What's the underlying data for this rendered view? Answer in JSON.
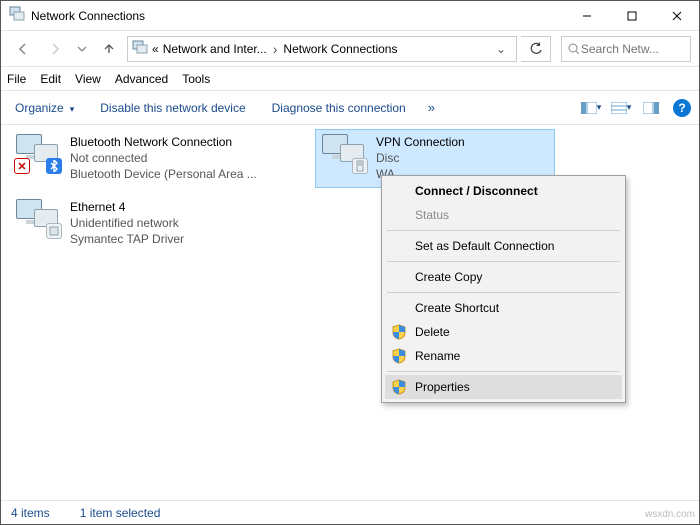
{
  "window": {
    "title": "Network Connections"
  },
  "nav": {
    "crumb1": "Network and Inter...",
    "crumb2": "Network Connections",
    "ellipsis": "«"
  },
  "search": {
    "placeholder": "Search Netw..."
  },
  "menu": {
    "file": "File",
    "edit": "Edit",
    "view": "View",
    "advanced": "Advanced",
    "tools": "Tools"
  },
  "cmd": {
    "organize": "Organize",
    "disable": "Disable this network device",
    "diagnose": "Diagnose this connection"
  },
  "connections": [
    {
      "name": "Bluetooth Network Connection",
      "status": "Not connected",
      "device": "Bluetooth Device (Personal Area ...",
      "icon": "bt",
      "selected": false
    },
    {
      "name": "Ethernet 4",
      "status": "Unidentified network",
      "device": "Symantec TAP Driver",
      "icon": "tap",
      "selected": false
    },
    {
      "name": "VPN Connection",
      "status": "Disconnected",
      "device": "WAN Miniport",
      "icon": "srv",
      "selected": true
    }
  ],
  "context_menu": [
    {
      "label": "Connect / Disconnect",
      "bold": true,
      "shield": false
    },
    {
      "label": "Status",
      "disabled": true
    },
    {
      "sep": true
    },
    {
      "label": "Set as Default Connection"
    },
    {
      "sep": true
    },
    {
      "label": "Create Copy"
    },
    {
      "sep": true
    },
    {
      "label": "Create Shortcut"
    },
    {
      "label": "Delete",
      "shield": true
    },
    {
      "label": "Rename",
      "shield": true
    },
    {
      "sep": true
    },
    {
      "label": "Properties",
      "shield": true,
      "hl": true
    }
  ],
  "status_bar": {
    "count": "4 items",
    "selection": "1 item selected"
  },
  "watermark": "wsxdn.com"
}
